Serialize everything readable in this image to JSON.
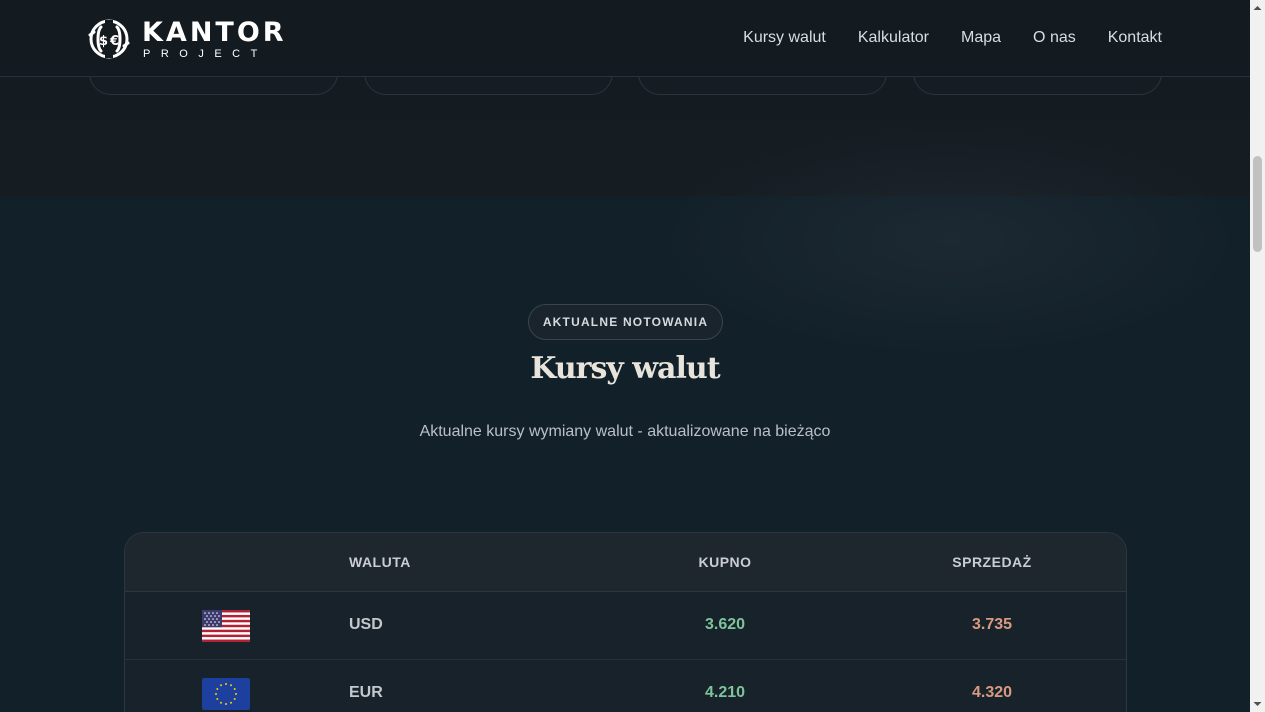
{
  "brand": {
    "name": "KANTOR",
    "sub": "PROJECT",
    "logo_icon": "currency-exchange-icon"
  },
  "nav": [
    {
      "label": "Kursy walut"
    },
    {
      "label": "Kalkulator"
    },
    {
      "label": "Mapa"
    },
    {
      "label": "O nas"
    },
    {
      "label": "Kontakt"
    }
  ],
  "section": {
    "badge": "AKTUALNE NOTOWANIA",
    "title": "Kursy walut",
    "subtitle": "Aktualne kursy wymiany walut - aktualizowane na bieżąco"
  },
  "table": {
    "headers": {
      "currency": "WALUTA",
      "buy": "KUPNO",
      "sell": "SPRZEDAŻ"
    },
    "rows": [
      {
        "flag": "us-flag-icon",
        "code": "USD",
        "buy": "3.620",
        "sell": "3.735"
      },
      {
        "flag": "eu-flag-icon",
        "code": "EUR",
        "buy": "4.210",
        "sell": "4.320"
      }
    ]
  },
  "colors": {
    "buy": "#7ec49a",
    "sell": "#d99a82",
    "background": "#131d24"
  }
}
